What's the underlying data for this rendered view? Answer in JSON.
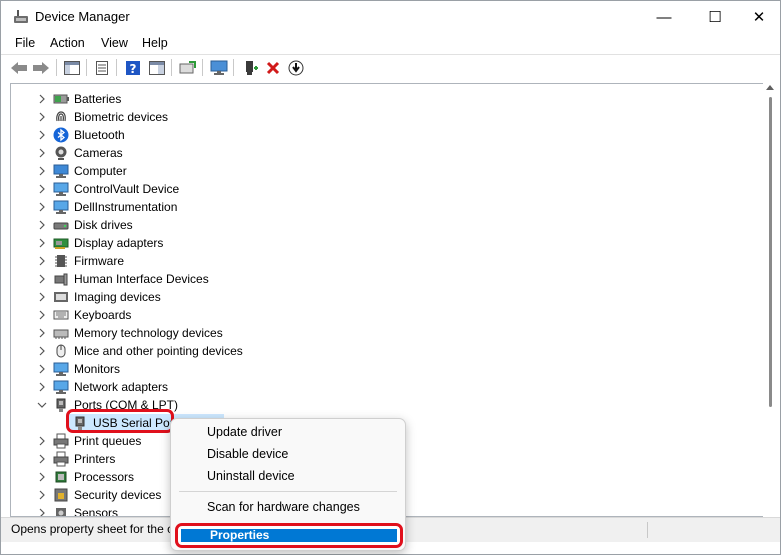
{
  "window": {
    "title": "Device Manager",
    "minimize_glyph": "—",
    "maximize_glyph": "☐",
    "close_glyph": "✕"
  },
  "menu": {
    "file": "File",
    "action": "Action",
    "view": "View",
    "help": "Help"
  },
  "toolbar": {
    "icons": [
      "back-arrow-icon",
      "forward-arrow-icon",
      "show-hide-console-tree-icon",
      "properties-icon",
      "help-icon",
      "action-pane-icon",
      "update-driver-icon",
      "monitor-icon",
      "add-driver-icon",
      "remove-device-icon",
      "download-driver-icon"
    ]
  },
  "tree": {
    "nodes": [
      {
        "label": "Batteries",
        "icon": "battery-icon"
      },
      {
        "label": "Biometric devices",
        "icon": "fingerprint-icon"
      },
      {
        "label": "Bluetooth",
        "icon": "bluetooth-icon"
      },
      {
        "label": "Cameras",
        "icon": "camera-icon"
      },
      {
        "label": "Computer",
        "icon": "computer-icon"
      },
      {
        "label": "ControlVault Device",
        "icon": "monitor-icon"
      },
      {
        "label": "DellInstrumentation",
        "icon": "monitor-icon"
      },
      {
        "label": "Disk drives",
        "icon": "disk-drive-icon"
      },
      {
        "label": "Display adapters",
        "icon": "display-adapter-icon"
      },
      {
        "label": "Firmware",
        "icon": "chip-icon"
      },
      {
        "label": "Human Interface Devices",
        "icon": "hid-icon"
      },
      {
        "label": "Imaging devices",
        "icon": "imaging-icon"
      },
      {
        "label": "Keyboards",
        "icon": "keyboard-icon"
      },
      {
        "label": "Memory technology devices",
        "icon": "memory-icon"
      },
      {
        "label": "Mice and other pointing devices",
        "icon": "mouse-icon"
      },
      {
        "label": "Monitors",
        "icon": "monitor-icon"
      },
      {
        "label": "Network adapters",
        "icon": "network-icon"
      },
      {
        "label": "Ports (COM & LPT)",
        "icon": "port-icon",
        "expanded": true
      },
      {
        "label": "USB Serial Port",
        "icon": "port-icon",
        "child": true,
        "selected": true
      },
      {
        "label": "Print queues",
        "icon": "printer-icon"
      },
      {
        "label": "Printers",
        "icon": "printer-icon"
      },
      {
        "label": "Processors",
        "icon": "processor-icon"
      },
      {
        "label": "Security devices",
        "icon": "security-icon"
      },
      {
        "label": "Sensors",
        "icon": "sensor-icon"
      }
    ]
  },
  "status": {
    "text": "Opens property sheet for the c"
  },
  "context_menu": {
    "update_driver": "Update driver",
    "disable_device": "Disable device",
    "uninstall_device": "Uninstall device",
    "scan": "Scan for hardware changes",
    "properties": "Properties"
  },
  "colors": {
    "selection": "#cce8ff",
    "accent": "#0078d4",
    "annotation": "#e0101c"
  }
}
